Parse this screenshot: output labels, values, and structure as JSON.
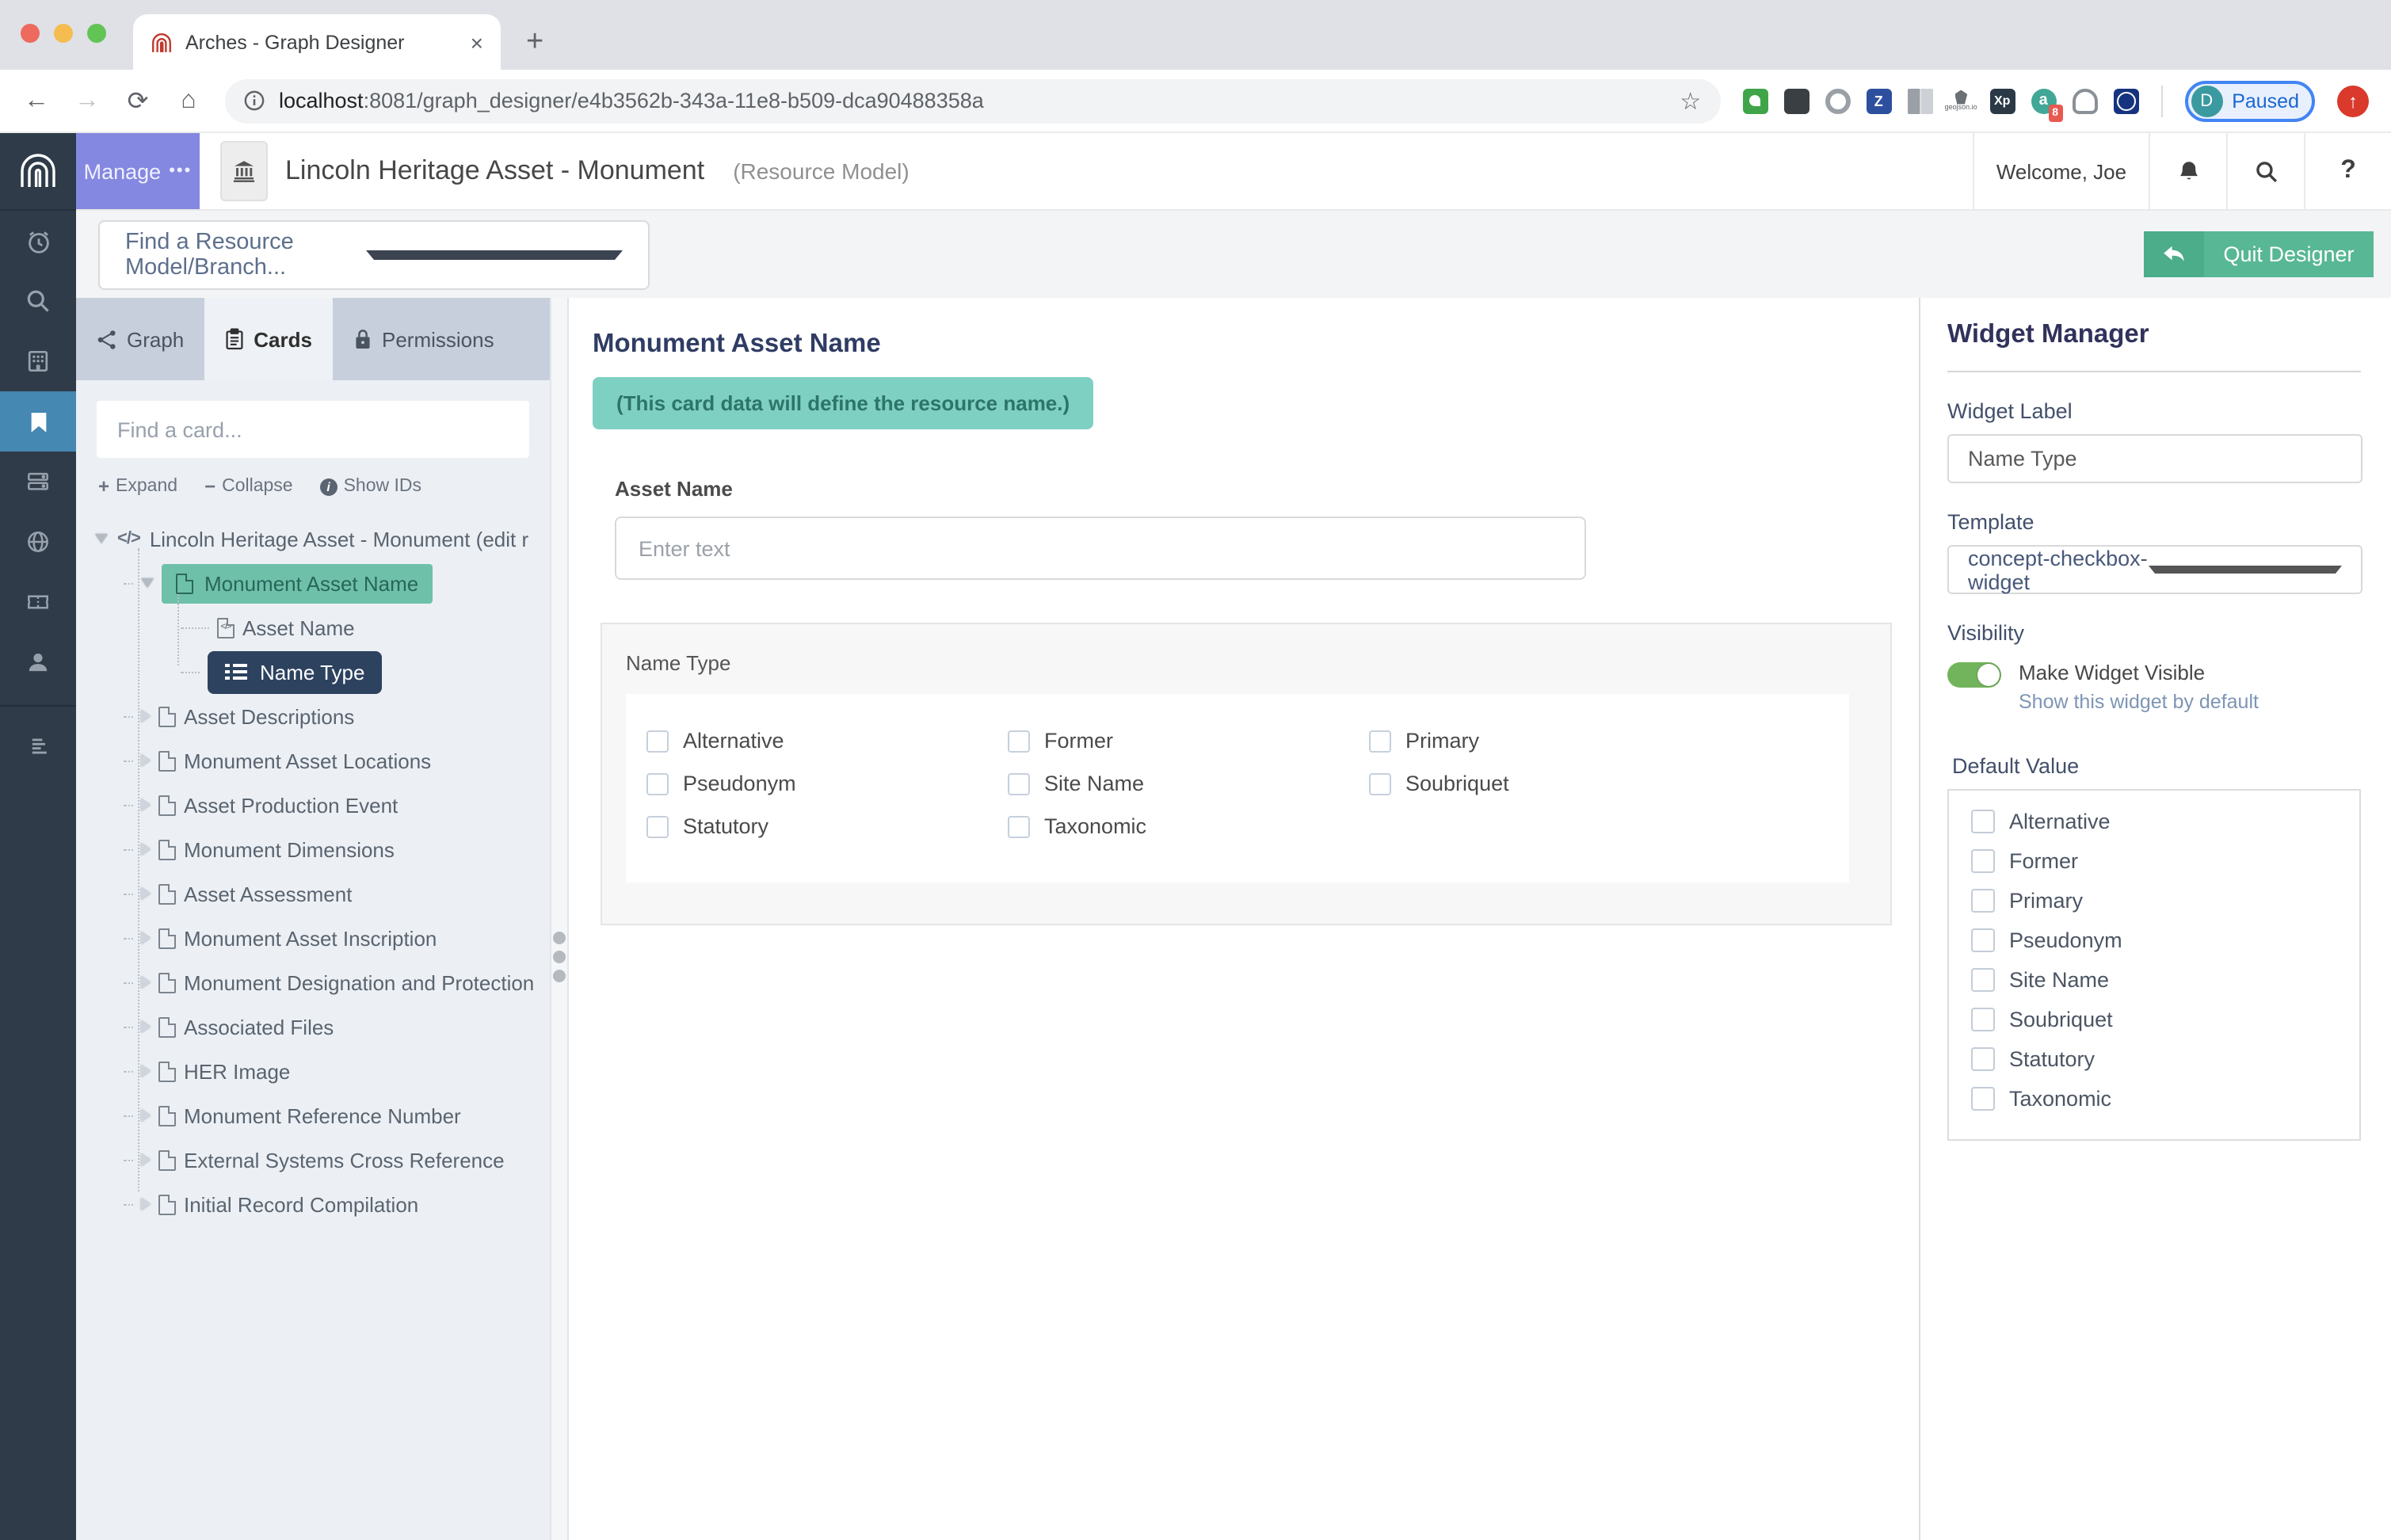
{
  "colors": {
    "accent_purple": "#8588e0",
    "sidebar_dark": "#2f3b49",
    "active_blue": "#4588b2",
    "tree_selected_teal": "#6fc0a9",
    "tree_selected_navy": "#2d425f",
    "banner_teal": "#7ed0c3",
    "quit_green": "#58b795",
    "toggle_green": "#72b45b"
  },
  "browser": {
    "tab_title": "Arches - Graph Designer",
    "close_glyph": "×",
    "new_tab_glyph": "+",
    "back_glyph": "←",
    "forward_glyph": "→",
    "reload_glyph": "⟳",
    "home_glyph": "⌂",
    "star_glyph": "☆",
    "url_host": "localhost",
    "url_path": ":8081/graph_designer/e4b3562b-343a-11e8-b509-dca90488358a",
    "ext": {
      "zotero": "Z",
      "xp": "Xp",
      "annotate": "a",
      "annotate_badge": "8",
      "geojson": "geojson.io"
    },
    "profile": {
      "initial": "D",
      "status": "Paused"
    },
    "onetab_glyph": "↑"
  },
  "header": {
    "manage": "Manage",
    "manage_dots": "•••",
    "title": "Lincoln Heritage Asset - Monument",
    "subtitle": "(Resource Model)",
    "welcome": "Welcome, Joe",
    "help_glyph": "?"
  },
  "toolbar": {
    "model_select_placeholder": "Find a Resource Model/Branch...",
    "quit": "Quit Designer"
  },
  "cards_panel": {
    "tabs": [
      {
        "label": "Graph"
      },
      {
        "label": "Cards"
      },
      {
        "label": "Permissions"
      }
    ],
    "active_tab": "Cards",
    "search_placeholder": "Find a card...",
    "actions": {
      "expand_glyph": "+",
      "expand": "Expand",
      "collapse_glyph": "−",
      "collapse": "Collapse",
      "info_glyph": "i",
      "show_ids": "Show IDs"
    },
    "tree": {
      "root_glyph": "</>",
      "root": "Lincoln Heritage Asset - Monument (edit r",
      "selected_card": "Monument Asset Name",
      "children": [
        "Asset Name",
        "Name Type"
      ],
      "selected_node": "Name Type",
      "cards": [
        "Asset Descriptions",
        "Monument Asset Locations",
        "Asset Production Event",
        "Monument Dimensions",
        "Asset Assessment",
        "Monument Asset Inscription",
        "Monument Designation and Protection",
        "Associated Files",
        "HER Image",
        "Monument Reference Number",
        "External Systems Cross Reference",
        "Initial Record Compilation"
      ]
    }
  },
  "main": {
    "card_title": "Monument Asset Name",
    "banner": "(This card data will define the resource name.)",
    "asset_name_label": "Asset Name",
    "asset_name_placeholder": "Enter text",
    "name_type_label": "Name Type",
    "options": [
      "Alternative",
      "Former",
      "Primary",
      "Pseudonym",
      "Site Name",
      "Soubriquet",
      "Statutory",
      "Taxonomic"
    ]
  },
  "widget_manager": {
    "title": "Widget Manager",
    "widget_label_label": "Widget Label",
    "widget_label_value": "Name Type",
    "template_label": "Template",
    "template_value": "concept-checkbox-widget",
    "visibility_label": "Visibility",
    "visible_label": "Make Widget Visible",
    "visible_sub": "Show this widget by default",
    "default_label": "Default Value",
    "default_options": [
      "Alternative",
      "Former",
      "Primary",
      "Pseudonym",
      "Site Name",
      "Soubriquet",
      "Statutory",
      "Taxonomic"
    ]
  }
}
